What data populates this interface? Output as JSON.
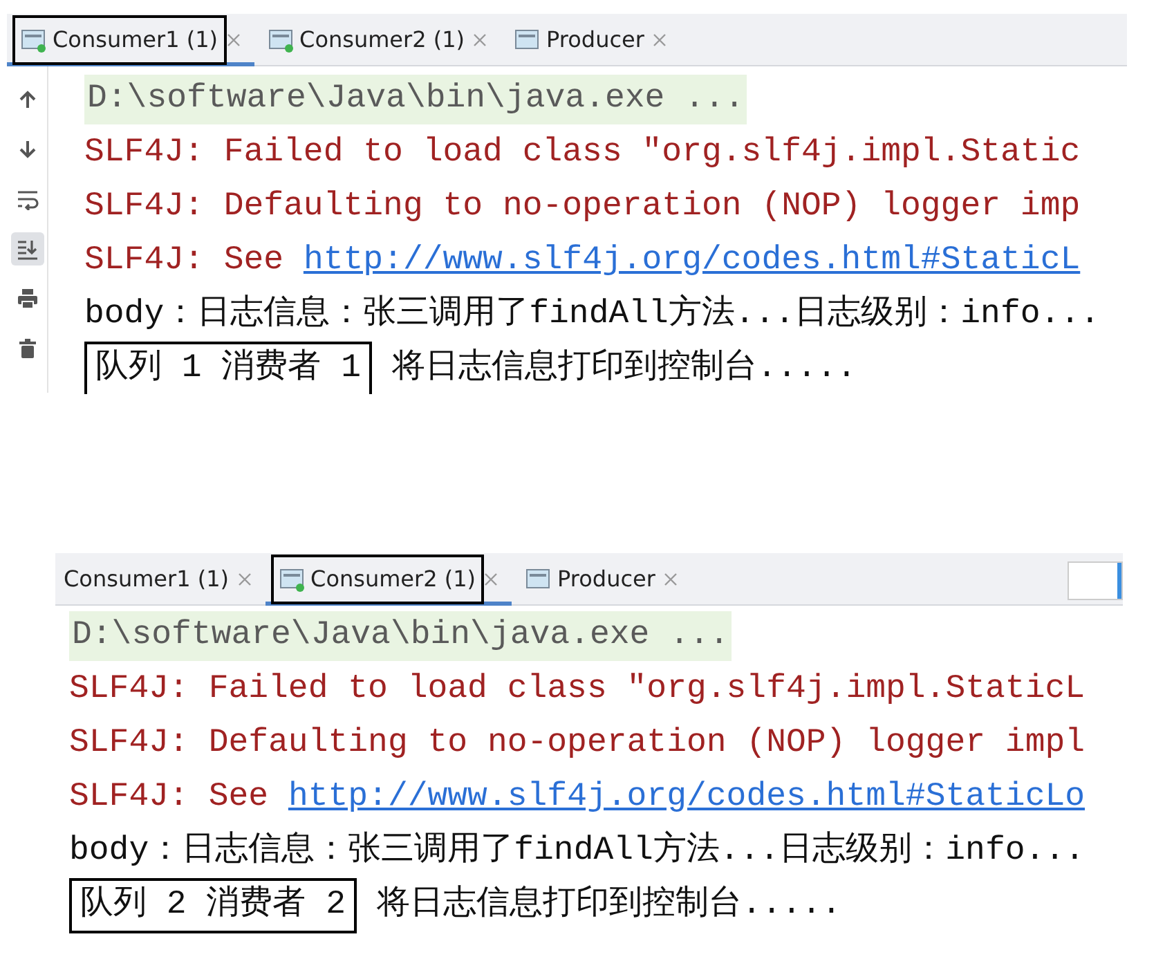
{
  "panels": [
    {
      "tabs": [
        {
          "label": "Consumer1 (1)",
          "selected": true,
          "highlighted": true,
          "running": true
        },
        {
          "label": "Consumer2 (1)",
          "selected": false,
          "highlighted": false,
          "running": true
        },
        {
          "label": "Producer",
          "selected": false,
          "highlighted": false,
          "running": false
        }
      ],
      "toolbar": [
        {
          "kind": "up",
          "selected": false
        },
        {
          "kind": "down",
          "selected": false
        },
        {
          "kind": "wrap",
          "selected": false
        },
        {
          "kind": "scroll-end",
          "selected": true
        },
        {
          "kind": "print",
          "selected": false
        },
        {
          "kind": "trash",
          "selected": false
        }
      ],
      "lines": [
        {
          "kind": "command",
          "text": "D:\\software\\Java\\bin\\java.exe ..."
        },
        {
          "kind": "error",
          "text": "SLF4J: Failed to load class \"org.slf4j.impl.Static"
        },
        {
          "kind": "error",
          "text": "SLF4J: Defaulting to no-operation (NOP) logger imp"
        },
        {
          "kind": "error",
          "text": "SLF4J: See ",
          "link": "http://www.slf4j.org/codes.html#StaticL"
        },
        {
          "kind": "output",
          "text": "body：日志信息：张三调用了findAll方法...日志级别：info..."
        },
        {
          "kind": "output",
          "boxed": "队列 1 消费者 1",
          "text": " 将日志信息打印到控制台....."
        }
      ]
    },
    {
      "tabs": [
        {
          "label": "Consumer1 (1)",
          "selected": false,
          "highlighted": false
        },
        {
          "label": "Consumer2 (1)",
          "selected": true,
          "highlighted": true,
          "running": true
        },
        {
          "label": "Producer",
          "selected": false,
          "highlighted": false,
          "running": false
        }
      ],
      "lines": [
        {
          "kind": "command",
          "text": "D:\\software\\Java\\bin\\java.exe ..."
        },
        {
          "kind": "error",
          "text": "SLF4J: Failed to load class \"org.slf4j.impl.StaticL"
        },
        {
          "kind": "error",
          "text": "SLF4J: Defaulting to no-operation (NOP) logger impl"
        },
        {
          "kind": "error",
          "text": "SLF4J: See ",
          "link": "http://www.slf4j.org/codes.html#StaticLo"
        },
        {
          "kind": "output",
          "text": "body：日志信息：张三调用了findAll方法...日志级别：info..."
        },
        {
          "kind": "output",
          "boxed": "队列 2 消费者 2",
          "text": " 将日志信息打印到控制台....."
        }
      ]
    }
  ]
}
